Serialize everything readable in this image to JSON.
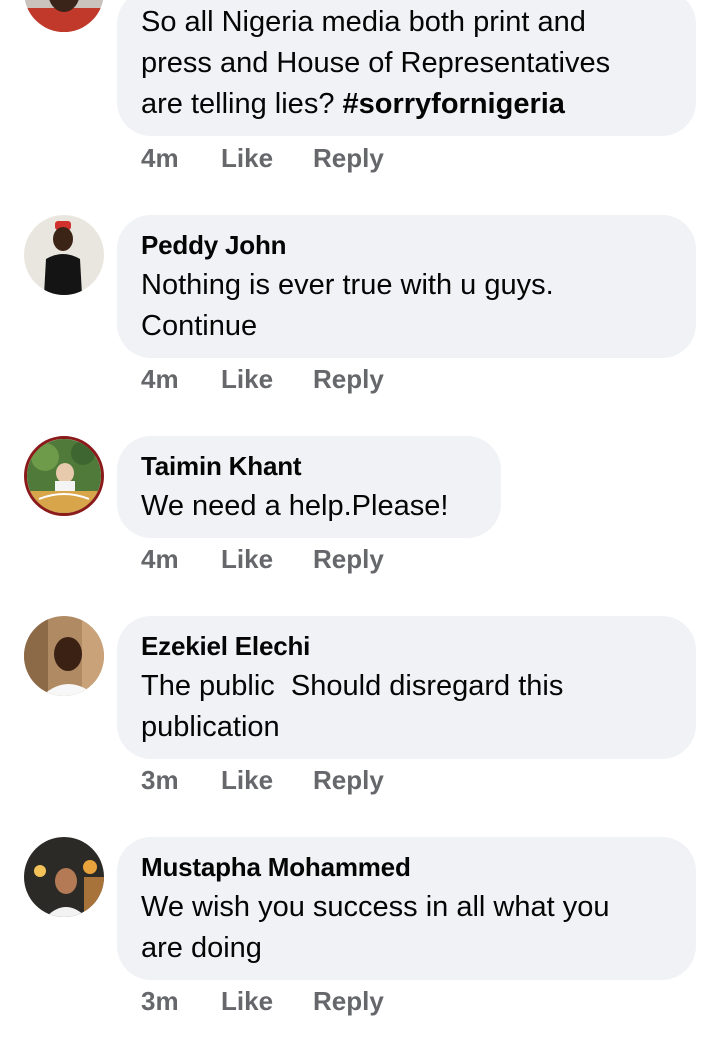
{
  "comments": [
    {
      "author": "",
      "text_prefix": "So all Nigeria media both print and\npress and House of Representatives\nare telling lies? ",
      "hashtag": "#sorryfornigeria",
      "time": "4m",
      "like_label": "Like",
      "reply_label": "Reply"
    },
    {
      "author": "Peddy John",
      "text": "Nothing is ever true with u guys.\nContinue",
      "time": "4m",
      "like_label": "Like",
      "reply_label": "Reply"
    },
    {
      "author": "Taimin Khant",
      "text": "We need a help.Please!",
      "time": "4m",
      "like_label": "Like",
      "reply_label": "Reply"
    },
    {
      "author": "Ezekiel Elechi",
      "text": "The public  Should disregard this\npublication",
      "time": "3m",
      "like_label": "Like",
      "reply_label": "Reply"
    },
    {
      "author": "Mustapha Mohammed",
      "text": "We wish you success in all what you\nare doing",
      "time": "3m",
      "like_label": "Like",
      "reply_label": "Reply"
    }
  ]
}
